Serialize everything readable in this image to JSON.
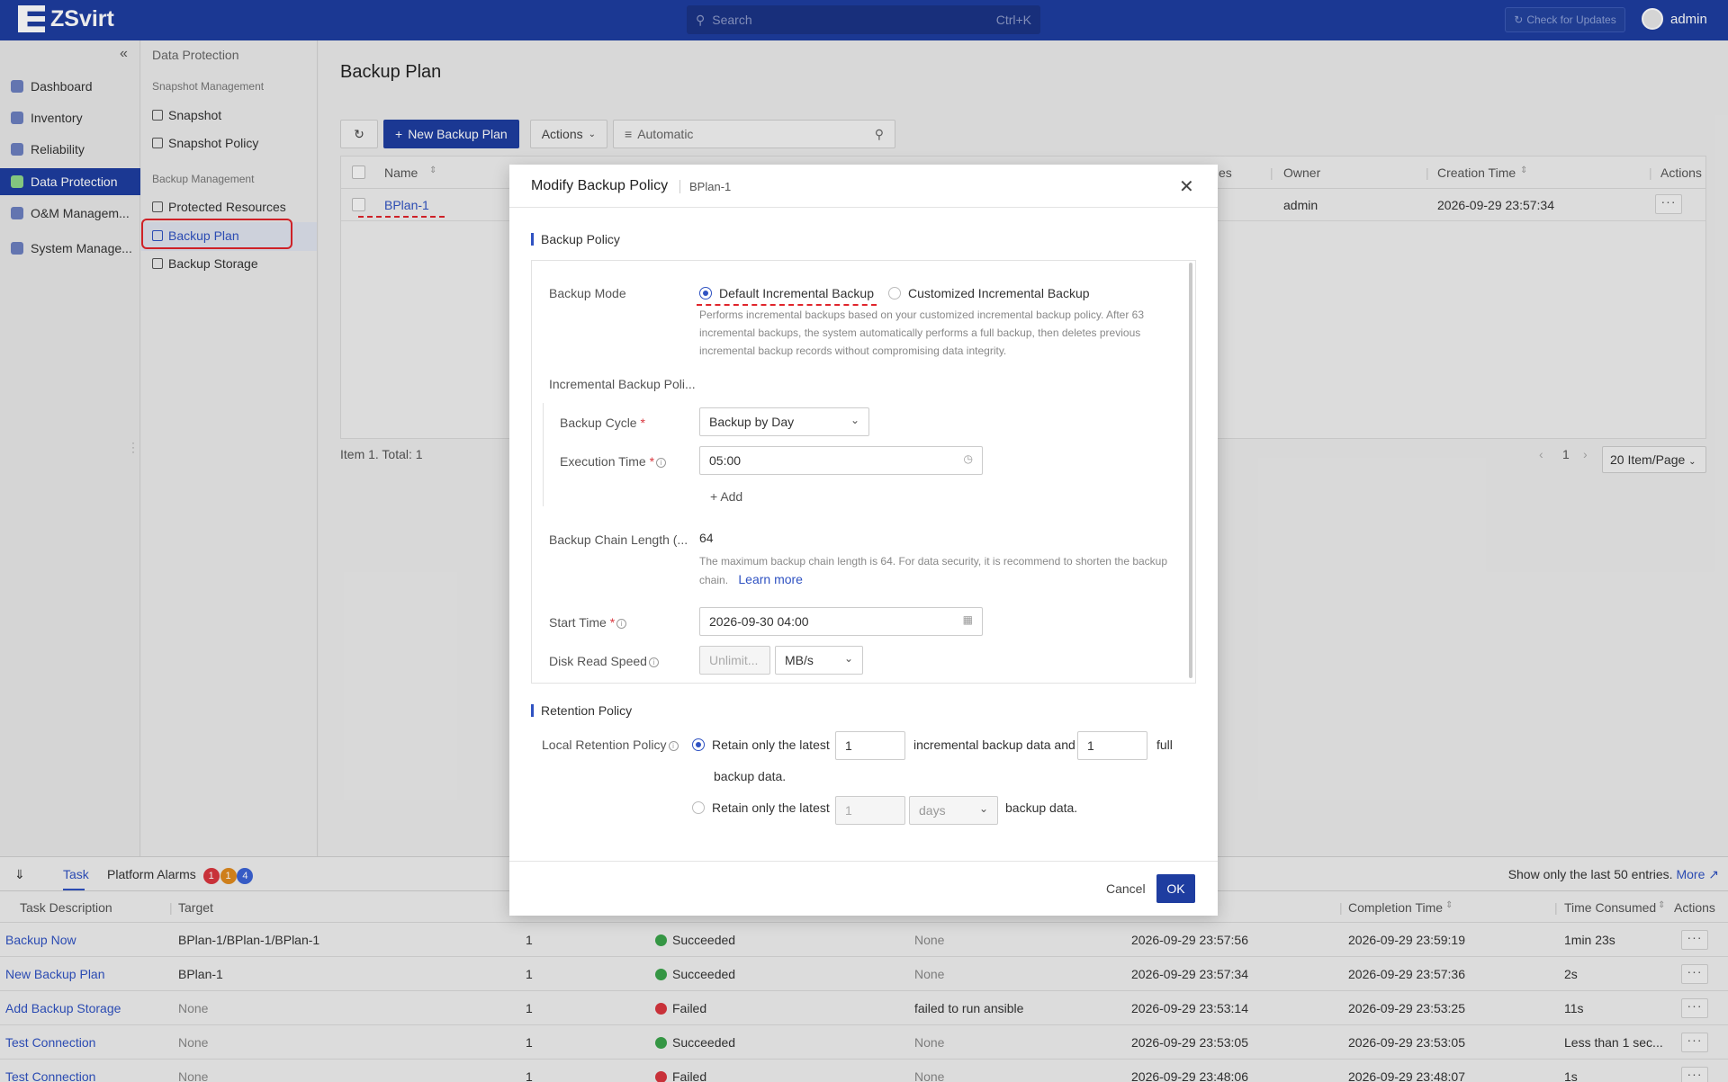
{
  "app": {
    "name": "ZSvirt",
    "search_placeholder": "Search",
    "search_shortcut": "Ctrl+K",
    "check_updates": "Check for Updates",
    "user": "admin"
  },
  "nav": {
    "items": [
      {
        "label": "Dashboard",
        "icon": "home-icon"
      },
      {
        "label": "Inventory",
        "icon": "inventory-icon"
      },
      {
        "label": "Reliability",
        "icon": "shield-icon"
      },
      {
        "label": "Data Protection",
        "icon": "data-protection-icon"
      },
      {
        "label": "O&M Managem...",
        "icon": "om-icon"
      },
      {
        "label": "System Manage...",
        "icon": "gear-icon"
      }
    ]
  },
  "subnav": {
    "title": "Data Protection",
    "group1": "Snapshot Management",
    "snapshot": "Snapshot",
    "snapshot_policy": "Snapshot Policy",
    "group2": "Backup Management",
    "protected_resources": "Protected Resources",
    "backup_plan": "Backup Plan",
    "backup_storage": "Backup Storage"
  },
  "page": {
    "title": "Backup Plan",
    "new_button": "New Backup Plan",
    "actions_button": "Actions",
    "filter_text": "Automatic",
    "columns": {
      "name": "Name",
      "es": "es",
      "owner": "Owner",
      "creation_time": "Creation Time",
      "actions": "Actions"
    },
    "row": {
      "name": "BPlan-1",
      "owner": "admin",
      "creation_time": "2026-09-29 23:57:34"
    },
    "total": "Item 1. Total: 1",
    "page_number": "1",
    "page_size": "20 Item/Page"
  },
  "modal": {
    "title": "Modify Backup Policy",
    "subtitle": "BPlan-1",
    "section_backup": "Backup Policy",
    "backup_mode_label": "Backup Mode",
    "mode_default": "Default Incremental Backup",
    "mode_custom": "Customized Incremental Backup",
    "mode_hint_1": "Performs incremental backups based on your customized incremental backup policy. After 63",
    "mode_hint_2": "incremental backups, the system automatically performs a full backup, then deletes previous",
    "mode_hint_3": "incremental backup records without compromising data integrity.",
    "incremental_label": "Incremental Backup Poli...",
    "cycle_label": "Backup Cycle",
    "cycle_value": "Backup by Day",
    "exec_label": "Execution Time",
    "exec_value": "05:00",
    "add": "Add",
    "chain_label": "Backup Chain Length (...",
    "chain_value": "64",
    "chain_hint_1": "The maximum backup chain length is 64. For data security, it is recommend to shorten the backup",
    "chain_hint_2": "chain.",
    "learn_more": "Learn more",
    "start_label": "Start Time",
    "start_value": "2026-09-30 04:00",
    "disk_label": "Disk Read Speed",
    "disk_placeholder": "Unlimit...",
    "disk_unit": "MB/s",
    "section_retention": "Retention Policy",
    "local_label": "Local Retention Policy",
    "retain_latest": "Retain only the latest",
    "retain_value1": "1",
    "incr_and": "incremental backup data and",
    "retain_value2": "1",
    "full": "full",
    "backup_data": "backup data.",
    "retain_latest2": "Retain only the latest",
    "retain_days_value": "1",
    "days": "days",
    "backup_data2": "backup data.",
    "cancel": "Cancel",
    "ok": "OK"
  },
  "bottom": {
    "tab_task": "Task",
    "tab_alarms": "Platform Alarms",
    "badges": [
      "1",
      "1",
      "4"
    ],
    "note": "Show only the last 50 entries.",
    "more": "More",
    "columns": {
      "desc": "Task Description",
      "target": "Target",
      "completion": "Completion Time",
      "consumed": "Time Consumed",
      "actions": "Actions"
    },
    "rows": [
      {
        "desc": "Backup Now",
        "target": "BPlan-1/BPlan-1/BPlan-1",
        "count": "1",
        "status": "Succeeded",
        "error": "None",
        "start": "2026-09-29 23:57:56",
        "end": "2026-09-29 23:59:19",
        "time": "1min 23s"
      },
      {
        "desc": "New Backup Plan",
        "target": "BPlan-1",
        "count": "1",
        "status": "Succeeded",
        "error": "None",
        "start": "2026-09-29 23:57:34",
        "end": "2026-09-29 23:57:36",
        "time": "2s"
      },
      {
        "desc": "Add Backup Storage",
        "target": "None",
        "count": "1",
        "status": "Failed",
        "error": "failed to run ansible",
        "start": "2026-09-29 23:53:14",
        "end": "2026-09-29 23:53:25",
        "time": "11s"
      },
      {
        "desc": "Test Connection",
        "target": "None",
        "count": "1",
        "status": "Succeeded",
        "error": "None",
        "start": "2026-09-29 23:53:05",
        "end": "2026-09-29 23:53:05",
        "time": "Less than 1 sec..."
      },
      {
        "desc": "Test Connection",
        "target": "None",
        "count": "1",
        "status": "Failed",
        "error": "None",
        "start": "2026-09-29 23:48:06",
        "end": "2026-09-29 23:48:07",
        "time": "1s"
      }
    ]
  },
  "colors": {
    "brand": "#1e3da0",
    "link": "#2f52c2",
    "success": "#3aa34a",
    "fail": "#d9363e",
    "highlight": "#e0242b"
  }
}
